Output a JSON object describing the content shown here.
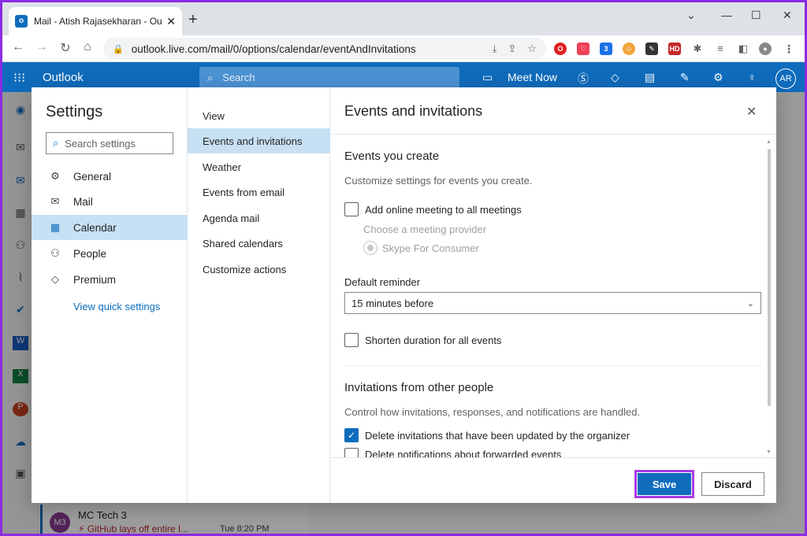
{
  "browser": {
    "tab_title": "Mail - Atish Rajasekharan - Outlo",
    "url": "outlook.live.com/mail/0/options/calendar/eventAndInvitations"
  },
  "outlook_header": {
    "brand": "Outlook",
    "search_placeholder": "Search",
    "meet_now": "Meet Now",
    "avatar_initials": "AR"
  },
  "background_mail": {
    "avatar": "M3",
    "from": "MC Tech 3",
    "subject": "GitHub lays off entire I...",
    "time": "Tue 8:20 PM"
  },
  "settings": {
    "title": "Settings",
    "search_placeholder": "Search settings",
    "categories": [
      {
        "label": "General",
        "icon": "gear-icon"
      },
      {
        "label": "Mail",
        "icon": "envelope-icon"
      },
      {
        "label": "Calendar",
        "icon": "calendar-icon"
      },
      {
        "label": "People",
        "icon": "people-icon"
      },
      {
        "label": "Premium",
        "icon": "diamond-icon"
      }
    ],
    "view_quick_settings": "View quick settings",
    "subcategories": [
      "View",
      "Events and invitations",
      "Weather",
      "Events from email",
      "Agenda mail",
      "Shared calendars",
      "Customize actions"
    ]
  },
  "pane": {
    "title": "Events and invitations",
    "events_you_create": {
      "heading": "Events you create",
      "description": "Customize settings for events you create.",
      "add_online_meeting": "Add online meeting to all meetings",
      "choose_provider": "Choose a meeting provider",
      "provider_option": "Skype For Consumer",
      "default_reminder_label": "Default reminder",
      "default_reminder_value": "15 minutes before",
      "shorten_duration": "Shorten duration for all events"
    },
    "invitations": {
      "heading": "Invitations from other people",
      "description": "Control how invitations, responses, and notifications are handled.",
      "delete_updated": "Delete invitations that have been updated by the organizer",
      "delete_forwarded": "Delete notifications about forwarded events"
    },
    "save_label": "Save",
    "discard_label": "Discard"
  }
}
